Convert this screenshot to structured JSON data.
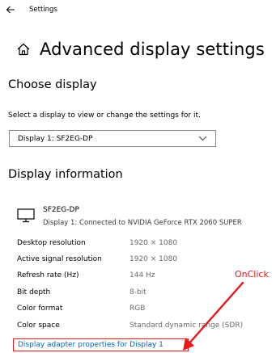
{
  "window": {
    "app_title": "Settings"
  },
  "header": {
    "page_title": "Advanced display settings"
  },
  "choose_display": {
    "section_title": "Choose display",
    "description": "Select a display to view or change the settings for it.",
    "selected_display": "Display 1: SF2EG-DP"
  },
  "display_info": {
    "section_title": "Display information",
    "monitor_name": "SF2EG-DP",
    "monitor_connection": "Display 1: Connected to NVIDIA GeForce RTX 2060 SUPER",
    "rows": [
      {
        "label": "Desktop resolution",
        "value": "1920 × 1080"
      },
      {
        "label": "Active signal resolution",
        "value": "1920 × 1080"
      },
      {
        "label": "Refresh rate (Hz)",
        "value": "144 Hz"
      },
      {
        "label": "Bit depth",
        "value": "8-bit"
      },
      {
        "label": "Color format",
        "value": "RGB"
      },
      {
        "label": "Color space",
        "value": "Standard dynamic range (SDR)"
      }
    ],
    "adapter_link": "Display adapter properties for Display 1"
  },
  "annotation": {
    "text": "OnClick",
    "color": "#e81818"
  },
  "colors": {
    "link": "#0067c0",
    "value_text": "#6b6b6b",
    "annotation": "#e81818"
  }
}
